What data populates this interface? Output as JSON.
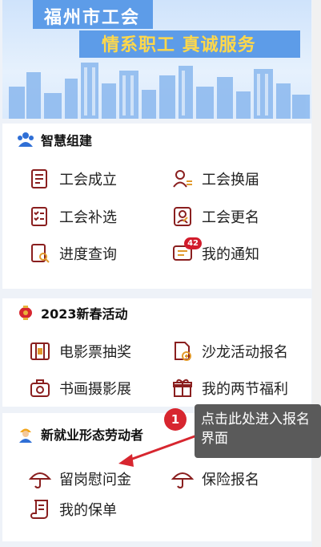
{
  "banner": {
    "line1": "福州市工会",
    "line2": "情系职工  真诚服务"
  },
  "sections": [
    {
      "title": "智慧组建",
      "icon": "people-group-icon",
      "items": [
        {
          "label": "工会成立",
          "icon": "building-doc-icon"
        },
        {
          "label": "工会换届",
          "icon": "user-list-icon"
        },
        {
          "label": "工会补选",
          "icon": "checklist-icon"
        },
        {
          "label": "工会更名",
          "icon": "user-edit-icon"
        },
        {
          "label": "进度查询",
          "icon": "doc-search-icon"
        },
        {
          "label": "我的通知",
          "icon": "message-icon",
          "badge": "42"
        }
      ]
    },
    {
      "title": "2023新春活动",
      "icon": "lantern-icon",
      "items": [
        {
          "label": "电影票抽奖",
          "icon": "film-icon"
        },
        {
          "label": "沙龙活动报名",
          "icon": "pen-doc-icon"
        },
        {
          "label": "书画摄影展",
          "icon": "camera-icon"
        },
        {
          "label": "我的两节福利",
          "icon": "gift-icon"
        }
      ]
    },
    {
      "title": "新就业形态劳动者",
      "icon": "worker-icon",
      "items": [
        {
          "label": "留岗慰问金",
          "icon": "umbrella-icon"
        },
        {
          "label": "保险报名",
          "icon": "umbrella-icon"
        },
        {
          "label": "我的保单",
          "icon": "scroll-icon"
        }
      ]
    }
  ],
  "tooltip": {
    "marker": "1",
    "text": "点击此处进入报名界面"
  },
  "colors": {
    "icon": "#8a1f1f",
    "banner_blue": "#5d9ce8",
    "banner_yellow": "#ffd84a",
    "marker": "#d7262f"
  }
}
